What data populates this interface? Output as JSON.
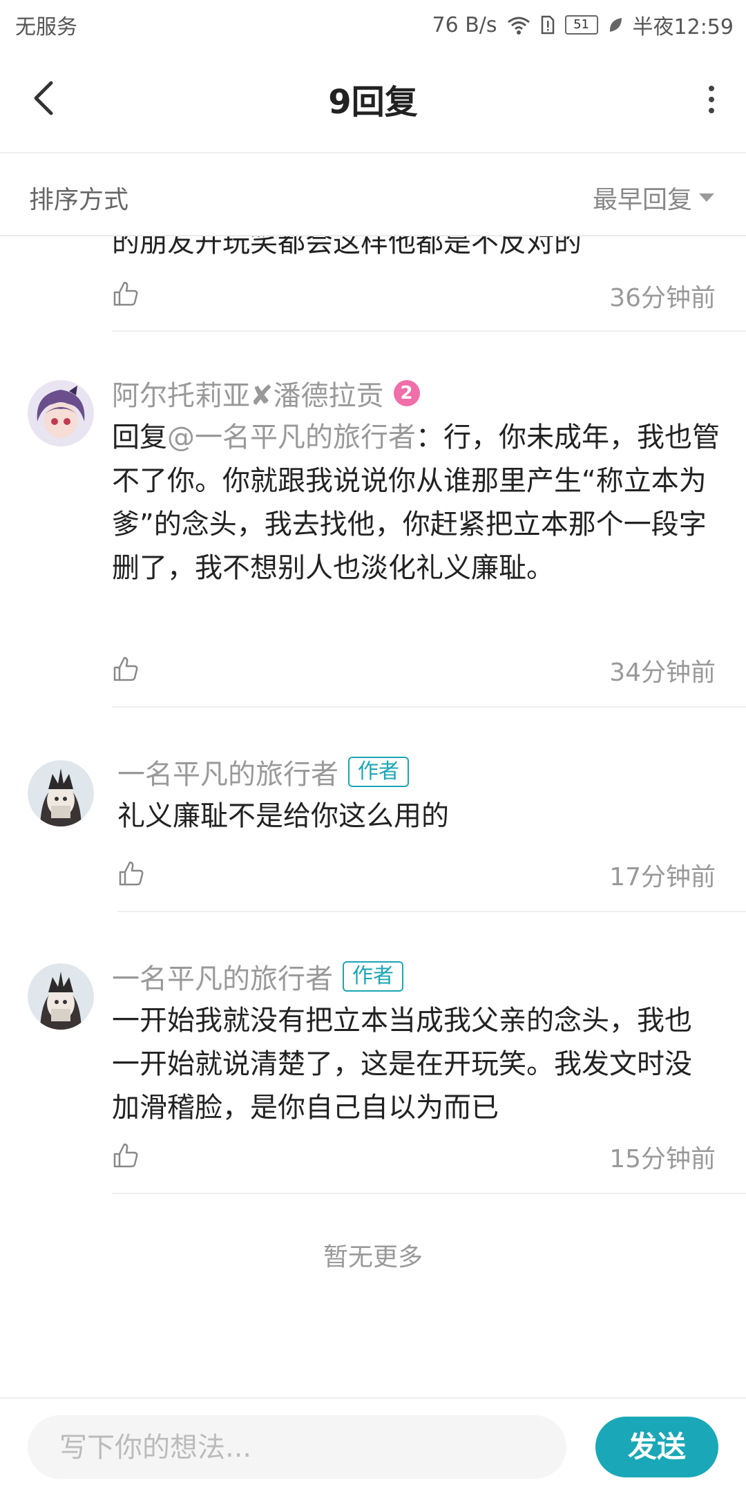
{
  "status_bar": {
    "carrier": "无服务",
    "speed": "76 B/s",
    "battery": "51",
    "time": "半夜12:59"
  },
  "header": {
    "title": "9回复"
  },
  "sort": {
    "label": "排序方式",
    "value": "最早回复"
  },
  "comments": [
    {
      "text": "的朋友开玩笑都会这样他都是不反对的",
      "time": "36分钟前"
    },
    {
      "name": "阿尔托莉亚✘潘德拉贡",
      "level": "2",
      "reply_prefix": "回复",
      "mention": "@一名平凡的旅行者",
      "text": "：行，你未成年，我也管不了你。你就跟我说说你从谁那里产生“称立本为爹”的念头，我去找他，你赶紧把立本那个一段字删了，我不想别人也淡化礼义廉耻。",
      "time": "34分钟前"
    },
    {
      "name": "一名平凡的旅行者",
      "badge": "作者",
      "text": "礼义廉耻不是给你这么用的",
      "time": "17分钟前"
    },
    {
      "name": "一名平凡的旅行者",
      "badge": "作者",
      "text": "一开始我就没有把立本当成我父亲的念头，我也一开始就说清楚了，这是在开玩笑。我发文时没加滑稽脸，是你自己自以为而已",
      "time": "15分钟前"
    }
  ],
  "footer_note": "暂无更多",
  "composer": {
    "placeholder": "写下你的想法...",
    "send_label": "发送"
  },
  "colors": {
    "accent": "#1aa8b8",
    "level_badge": "#f06ea9"
  }
}
